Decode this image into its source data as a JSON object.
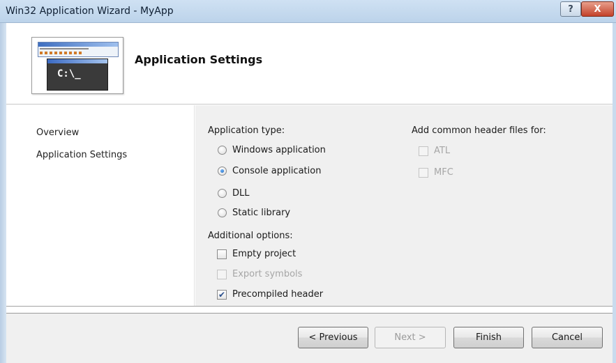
{
  "window": {
    "title": "Win32 Application Wizard - MyApp",
    "help_glyph": "?",
    "close_glyph": "X"
  },
  "header": {
    "title": "Application Settings",
    "console_text": "C:\\_",
    "image_icon": "console-application-icon"
  },
  "nav": {
    "items": [
      {
        "label": "Overview"
      },
      {
        "label": "Application Settings"
      }
    ]
  },
  "content": {
    "app_type": {
      "label": "Application type:",
      "options": [
        {
          "label": "Windows application",
          "selected": false
        },
        {
          "label": "Console application",
          "selected": true
        },
        {
          "label": "DLL",
          "selected": false
        },
        {
          "label": "Static library",
          "selected": false
        }
      ]
    },
    "additional": {
      "label": "Additional options:",
      "options": [
        {
          "label": "Empty project",
          "checked": false,
          "enabled": true
        },
        {
          "label": "Export symbols",
          "checked": false,
          "enabled": false
        },
        {
          "label": "Precompiled header",
          "checked": true,
          "enabled": true
        }
      ]
    },
    "common_headers": {
      "label": "Add common header files for:",
      "options": [
        {
          "label": "ATL",
          "checked": false,
          "enabled": false
        },
        {
          "label": "MFC",
          "checked": false,
          "enabled": false
        }
      ]
    }
  },
  "footer": {
    "previous": "< Previous",
    "next": "Next >",
    "finish": "Finish",
    "cancel": "Cancel"
  }
}
